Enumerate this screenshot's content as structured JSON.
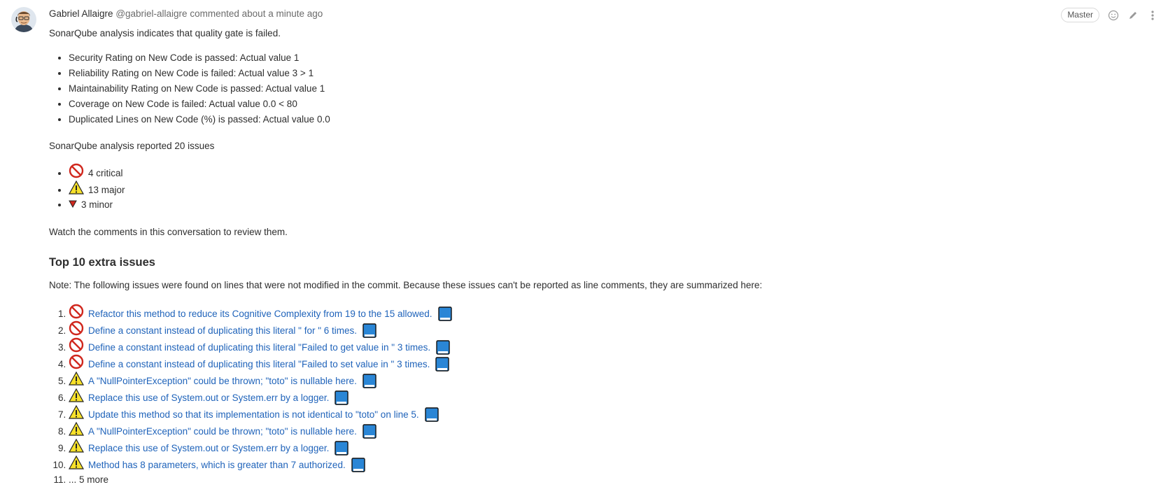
{
  "comment": {
    "author": "Gabriel Allaigre",
    "handle": "@gabriel-allaigre",
    "action": "commented",
    "time": "about a minute ago",
    "badge": "Master"
  },
  "body": {
    "intro": "SonarQube analysis indicates that quality gate is failed.",
    "quality_gate": [
      "Security Rating on New Code is passed: Actual value 1",
      "Reliability Rating on New Code is failed: Actual value 3 > 1",
      "Maintainability Rating on New Code is passed: Actual value 1",
      "Coverage on New Code is failed: Actual value 0.0 < 80",
      "Duplicated Lines on New Code (%) is passed: Actual value 0.0"
    ],
    "issues_summary": "SonarQube analysis reported 20 issues",
    "severities": [
      {
        "icon": "critical-icon",
        "label": "4 critical"
      },
      {
        "icon": "major-icon",
        "label": "13 major"
      },
      {
        "icon": "minor-icon",
        "label": "3 minor"
      }
    ],
    "watch": "Watch the comments in this conversation to review them.",
    "extra_heading": "Top 10 extra issues",
    "note": "Note: The following issues were found on lines that were not modified in the commit. Because these issues can't be reported as line comments, they are summarized here:",
    "issues": [
      {
        "severity": "critical",
        "text": "Refactor this method to reduce its Cognitive Complexity from 19 to the 15 allowed."
      },
      {
        "severity": "critical",
        "text": "Define a constant instead of duplicating this literal \" for \" 6 times."
      },
      {
        "severity": "critical",
        "text": "Define a constant instead of duplicating this literal \"Failed to get value in \" 3 times."
      },
      {
        "severity": "critical",
        "text": "Define a constant instead of duplicating this literal \"Failed to set value in \" 3 times."
      },
      {
        "severity": "major",
        "text": "A \"NullPointerException\" could be thrown; \"toto\" is nullable here."
      },
      {
        "severity": "major",
        "text": "Replace this use of System.out or System.err by a logger."
      },
      {
        "severity": "major",
        "text": "Update this method so that its implementation is not identical to \"toto\" on line 5."
      },
      {
        "severity": "major",
        "text": "A \"NullPointerException\" could be thrown; \"toto\" is nullable here."
      },
      {
        "severity": "major",
        "text": "Replace this use of System.out or System.err by a logger."
      },
      {
        "severity": "major",
        "text": "Method has 8 parameters, which is greater than 7 authorized."
      }
    ],
    "more": "... 5 more"
  },
  "colors": {
    "link": "#1f63ba",
    "critical": "#d0271d",
    "major": "#f7e12a",
    "book": "#2a86d6"
  }
}
